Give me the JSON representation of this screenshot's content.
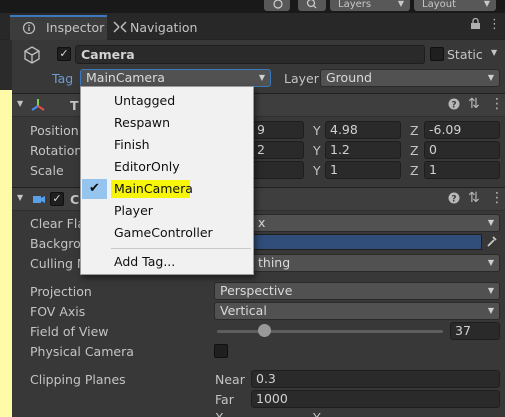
{
  "topbar": {
    "layers_label": "Layers",
    "layout_label": "Layout"
  },
  "tabs": [
    {
      "label": "Inspector",
      "active": true
    },
    {
      "label": "Navigation",
      "active": false
    }
  ],
  "header": {
    "object_name": "Camera",
    "static_label": "Static",
    "tag_label": "Tag",
    "tag_value": "MainCamera",
    "layer_label": "Layer",
    "layer_value": "Ground"
  },
  "transform": {
    "position_label": "Position",
    "rotation_label": "Rotation",
    "scale_label": "Scale",
    "position": {
      "x": "9",
      "y": "4.98",
      "z": "-6.09"
    },
    "rotation": {
      "x": "2",
      "y": "1.2",
      "z": "0"
    },
    "scale": {
      "x": "",
      "y": "1",
      "z": "1"
    },
    "axis_x": "X",
    "axis_y": "Y",
    "axis_z": "Z"
  },
  "camera": {
    "clear_flags_label": "Clear Fla",
    "clear_flags_value": "x",
    "background_label": "Backgro",
    "culling_label": "Culling M",
    "culling_value": "thing",
    "projection_label": "Projection",
    "projection_value": "Perspective",
    "fov_axis_label": "FOV Axis",
    "fov_axis_value": "Vertical",
    "fov_label": "Field of View",
    "fov_value": "37",
    "physical_label": "Physical Camera",
    "clipping_label": "Clipping Planes",
    "near_label": "Near",
    "near_value": "0.3",
    "far_label": "Far",
    "far_value": "1000",
    "background_color": "#314d79"
  },
  "tag_menu": {
    "items": [
      "Untagged",
      "Respawn",
      "Finish",
      "EditorOnly",
      "MainCamera",
      "Player",
      "GameController"
    ],
    "selected_index": 4,
    "add_tag": "Add Tag..."
  },
  "colors": {
    "highlight": "#f7f50a",
    "accent": "#3a79bb",
    "check_bg": "#95c5ee"
  }
}
